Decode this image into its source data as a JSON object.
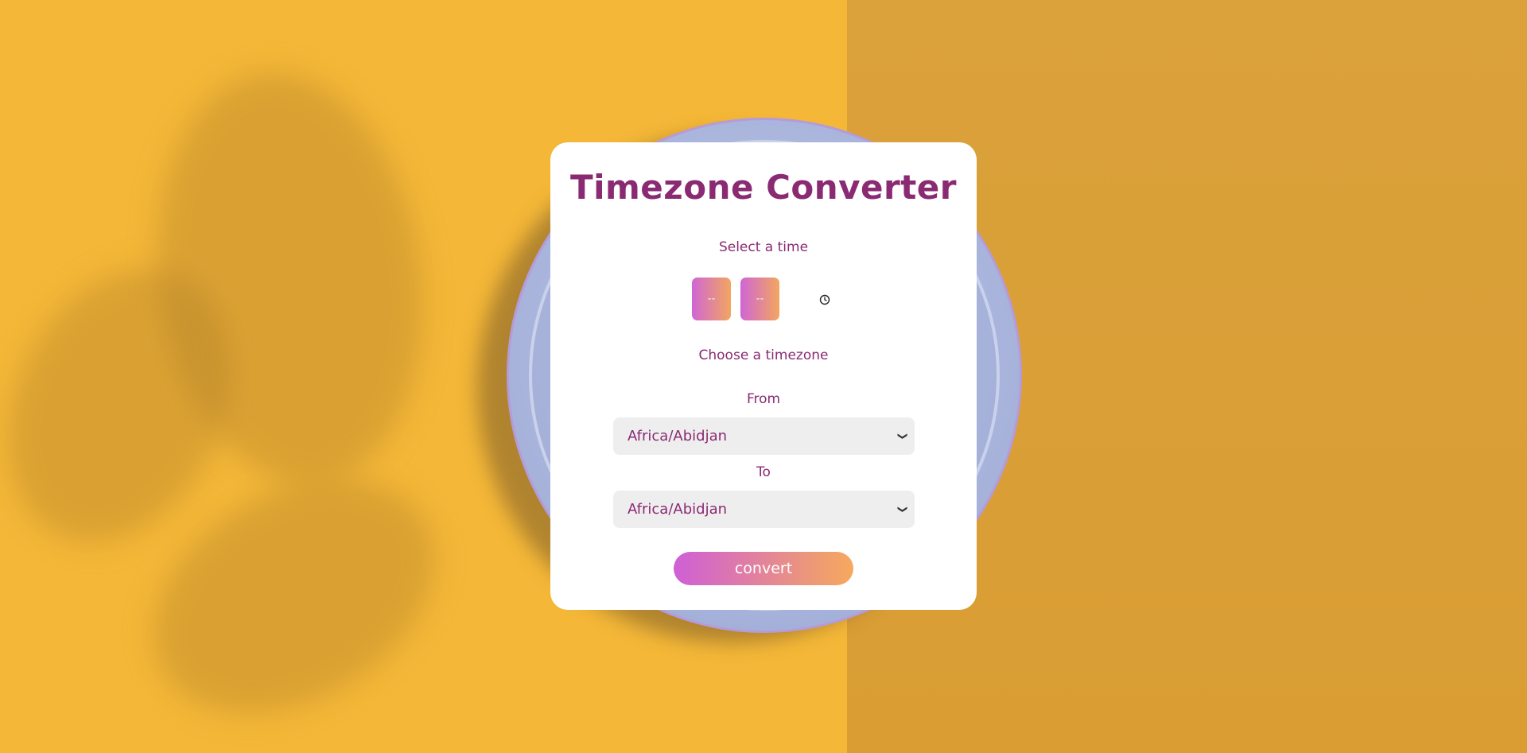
{
  "app": {
    "title": "Timezone Converter"
  },
  "time": {
    "label": "Select a time",
    "hour_value": "--",
    "minute_value": "--",
    "icon": "clock-icon"
  },
  "timezone": {
    "label": "Choose a timezone",
    "from_label": "From",
    "from_value": "Africa/Abidjan",
    "to_label": "To",
    "to_value": "Africa/Abidjan"
  },
  "actions": {
    "convert_label": "convert"
  },
  "colors": {
    "accent": "#8a2a73",
    "gradient_start": "#cf5fd7",
    "gradient_end": "#f6a95c",
    "background": "#f4b737"
  }
}
